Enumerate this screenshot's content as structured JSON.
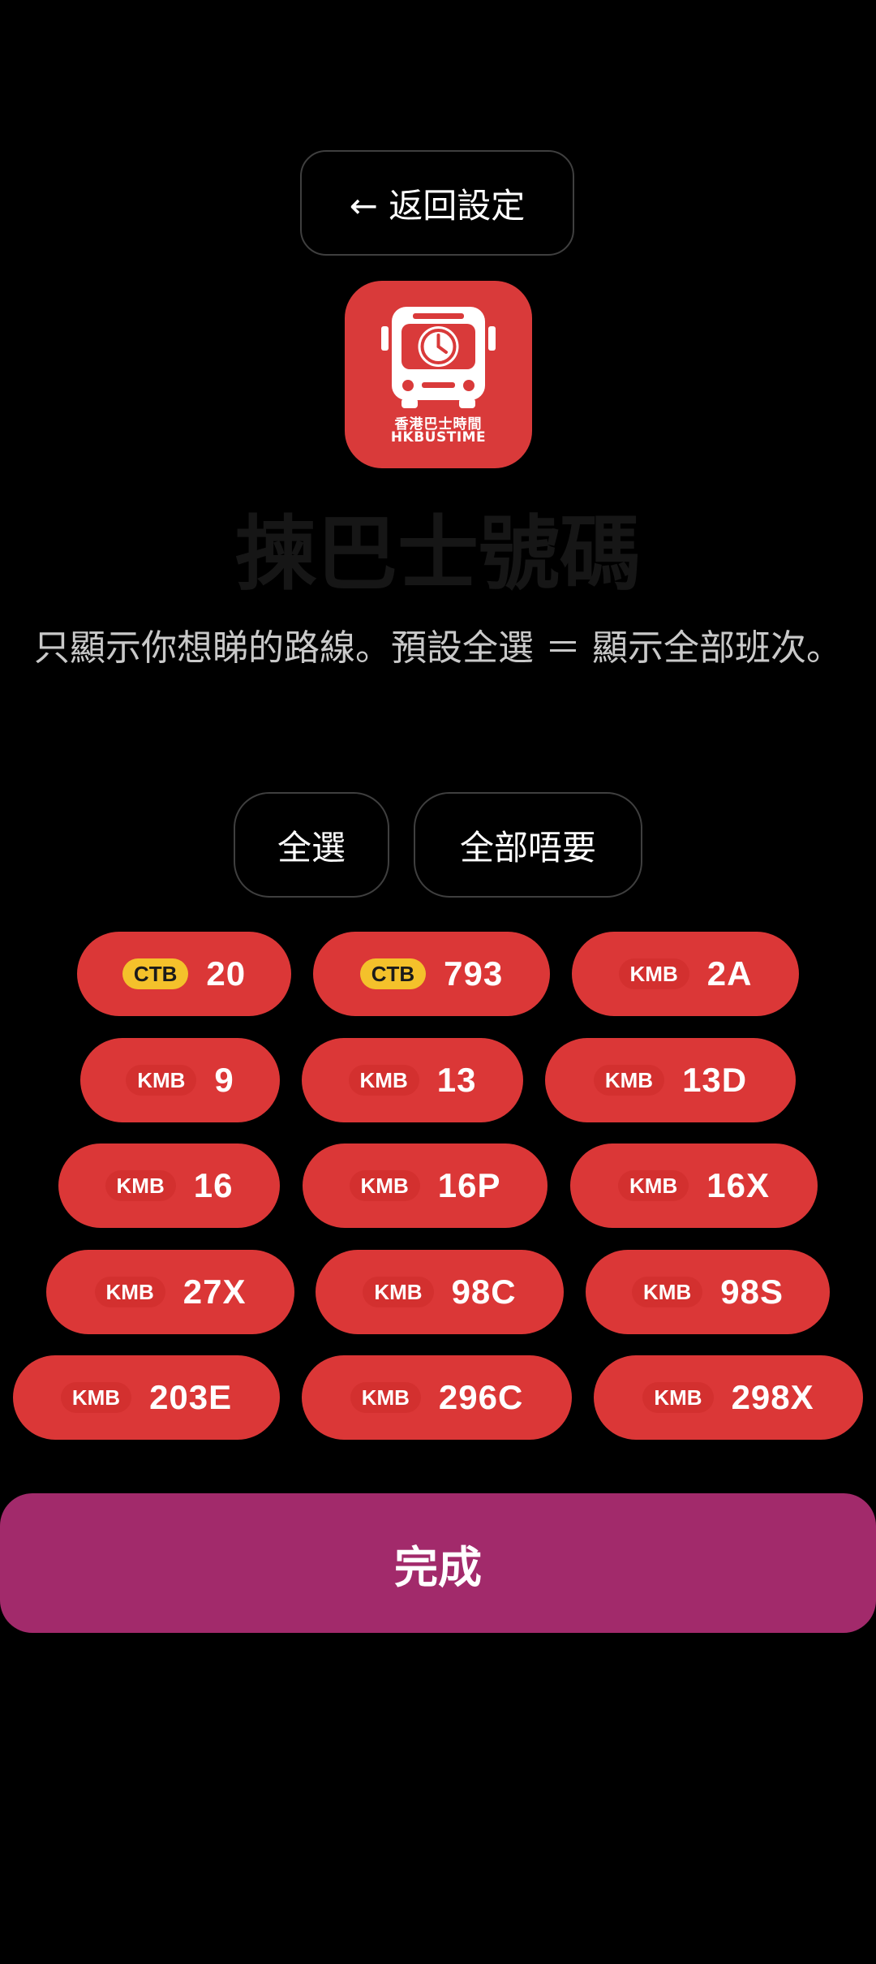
{
  "header": {
    "back_label": "← 返回設定"
  },
  "app_icon": {
    "name_zh": "香港巴士時間",
    "name_en": "HKBUSTIME",
    "background_color": "#d93a3a"
  },
  "title": "揀巴士號碼",
  "subtitle": "只顯示你想睇的路線。預設全選 ＝ 顯示全部班次。",
  "actions": {
    "select_all": "全選",
    "deselect_all": "全部唔要"
  },
  "routes": [
    {
      "operator": "CTB",
      "number": "20"
    },
    {
      "operator": "CTB",
      "number": "793"
    },
    {
      "operator": "KMB",
      "number": "2A"
    },
    {
      "operator": "KMB",
      "number": "9"
    },
    {
      "operator": "KMB",
      "number": "13"
    },
    {
      "operator": "KMB",
      "number": "13D"
    },
    {
      "operator": "KMB",
      "number": "16"
    },
    {
      "operator": "KMB",
      "number": "16P"
    },
    {
      "operator": "KMB",
      "number": "16X"
    },
    {
      "operator": "KMB",
      "number": "27X"
    },
    {
      "operator": "KMB",
      "number": "98C"
    },
    {
      "operator": "KMB",
      "number": "98S"
    },
    {
      "operator": "KMB",
      "number": "203E"
    },
    {
      "operator": "KMB",
      "number": "296C"
    },
    {
      "operator": "KMB",
      "number": "298X"
    }
  ],
  "done_label": "完成",
  "colors": {
    "chip": "#db3737",
    "ctb_badge": "#f4c12b",
    "done": "#a22a6b"
  }
}
